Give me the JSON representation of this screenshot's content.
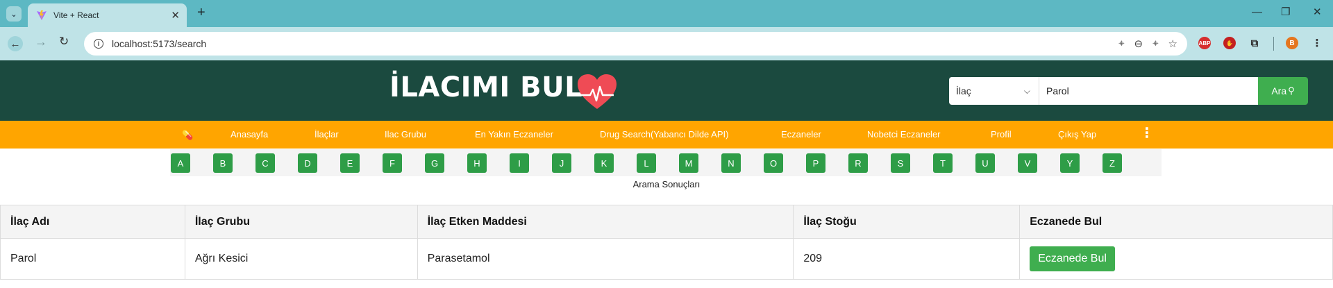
{
  "browser": {
    "tab_title": "Vite + React",
    "url": "localhost:5173/search",
    "profile_initial": "B",
    "ext_abp": "ABP"
  },
  "header": {
    "brand": "İLACIMI BUL",
    "search": {
      "category": "İlaç",
      "query": "Parol",
      "button_label": "Ara"
    }
  },
  "nav": {
    "items": [
      "Anasayfa",
      "İlaçlar",
      "Ilac Grubu",
      "En Yakın Eczaneler",
      "Drug Search(Yabancı Dilde API)",
      "Eczaneler",
      "Nobetci Eczaneler",
      "Profil",
      "Çıkış Yap"
    ]
  },
  "letters": [
    "A",
    "B",
    "C",
    "D",
    "E",
    "F",
    "G",
    "H",
    "I",
    "J",
    "K",
    "L",
    "M",
    "N",
    "O",
    "P",
    "R",
    "S",
    "T",
    "U",
    "V",
    "Y",
    "Z"
  ],
  "results": {
    "title": "Arama Sonuçları",
    "columns": [
      "İlaç Adı",
      "İlaç Grubu",
      "İlaç Etken Maddesi",
      "İlaç Stoğu",
      "Eczanede Bul"
    ],
    "rows": [
      {
        "name": "Parol",
        "group": "Ağrı Kesici",
        "ingredient": "Parasetamol",
        "stock": "209",
        "action": "Eczanede Bul"
      }
    ]
  },
  "colors": {
    "header_bg": "#1b4a3f",
    "nav_bg": "#ffa500",
    "accent_green": "#2e9d47",
    "browser_tabbar": "#5db8c3"
  }
}
